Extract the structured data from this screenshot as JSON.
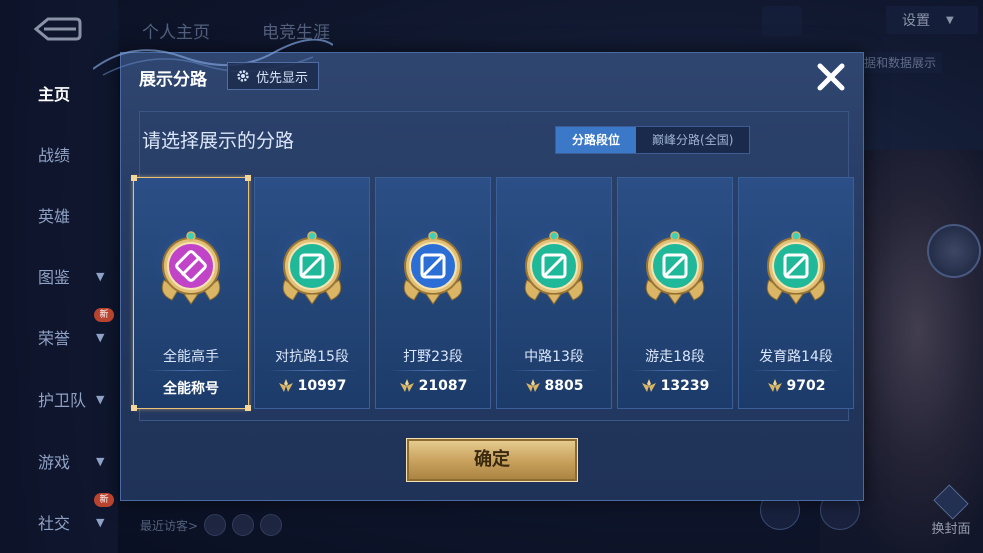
{
  "background": {
    "top_tabs": [
      "个人主页",
      "电竞生涯"
    ],
    "settings_label": "设置",
    "hint_text": "据和数据展示",
    "nav_items": [
      {
        "label": "主页",
        "active": true,
        "has_chevron": false
      },
      {
        "label": "战绩",
        "active": false,
        "has_chevron": false
      },
      {
        "label": "英雄",
        "active": false,
        "has_chevron": false
      },
      {
        "label": "图鉴",
        "active": false,
        "has_chevron": true
      },
      {
        "label": "荣誉",
        "active": false,
        "has_chevron": true,
        "badge": "新"
      },
      {
        "label": "护卫队",
        "active": false,
        "has_chevron": true
      },
      {
        "label": "游戏",
        "active": false,
        "has_chevron": true
      },
      {
        "label": "社交",
        "active": false,
        "has_chevron": true,
        "badge": "新"
      }
    ],
    "visitors_label": "最近访客>",
    "cover_button_label": "换封面"
  },
  "modal": {
    "title": "展示分路",
    "priority_button": "优先显示",
    "heading": "请选择展示的分路",
    "segments": [
      {
        "label": "分路段位",
        "active": true
      },
      {
        "label": "巅峰分路(全国)",
        "active": false
      }
    ],
    "cards": [
      {
        "name": "全能高手",
        "footer": "全能称号",
        "has_icon": false,
        "selected": true,
        "emblem_color": "#c043c8",
        "emblem": "allround-emblem-icon"
      },
      {
        "name": "对抗路15段",
        "footer": "10997",
        "has_icon": true,
        "selected": false,
        "emblem_color": "#1fb99a",
        "emblem": "clash-lane-emblem-icon"
      },
      {
        "name": "打野23段",
        "footer": "21087",
        "has_icon": true,
        "selected": false,
        "emblem_color": "#2b6fd6",
        "emblem": "jungle-emblem-icon"
      },
      {
        "name": "中路13段",
        "footer": "8805",
        "has_icon": true,
        "selected": false,
        "emblem_color": "#1fb99a",
        "emblem": "mid-lane-emblem-icon"
      },
      {
        "name": "游走18段",
        "footer": "13239",
        "has_icon": true,
        "selected": false,
        "emblem_color": "#1fb99a",
        "emblem": "roam-emblem-icon"
      },
      {
        "name": "发育路14段",
        "footer": "9702",
        "has_icon": true,
        "selected": false,
        "emblem_color": "#1fb99a",
        "emblem": "farm-lane-emblem-icon"
      }
    ],
    "confirm_button": "确定"
  },
  "colors": {
    "gold": "#e9c27a",
    "accent_blue": "#3b78c8",
    "teal": "#1fb99a",
    "purple": "#c043c8"
  }
}
